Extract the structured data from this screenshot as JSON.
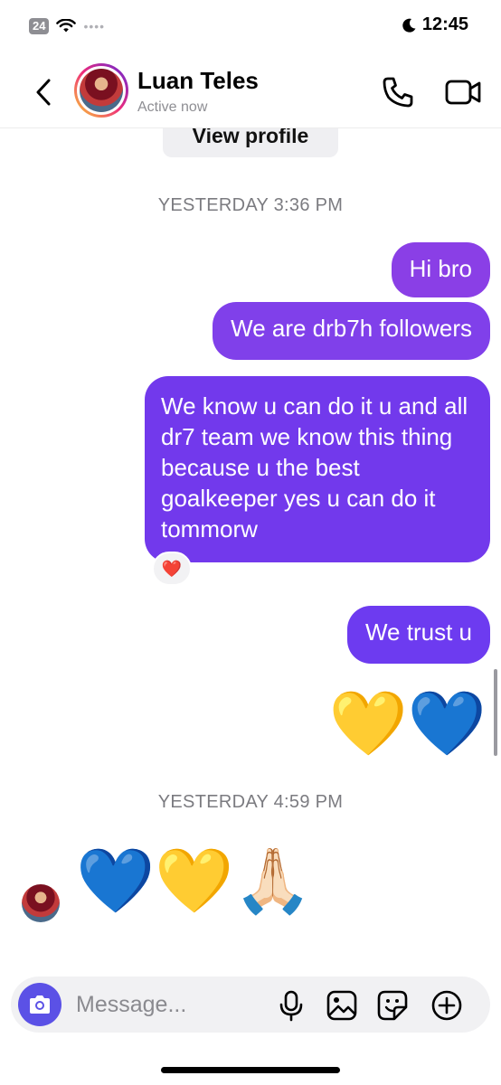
{
  "status_bar": {
    "battery": "24",
    "time": "12:45"
  },
  "header": {
    "contact_name": "Luan Teles",
    "contact_status": "Active now"
  },
  "chat": {
    "view_profile_label": "View profile",
    "timestamp_1": "YESTERDAY 3:36 PM",
    "timestamp_2": "YESTERDAY 4:59 PM",
    "messages": [
      {
        "text": "Hi bro"
      },
      {
        "text": "We are drb7h followers"
      },
      {
        "text": "We know u can do it u and all dr7 team we know this thing because u the best goalkeeper yes u can do it tommorw"
      },
      {
        "text": "We trust u"
      }
    ],
    "reaction": "❤️",
    "sent_emojis": "💛💙",
    "received_emojis": "💙💛🙏🏻"
  },
  "composer": {
    "placeholder": "Message..."
  },
  "colors": {
    "bubble_purple": "#7b3ff2",
    "camera_button": "#5b51e6"
  }
}
